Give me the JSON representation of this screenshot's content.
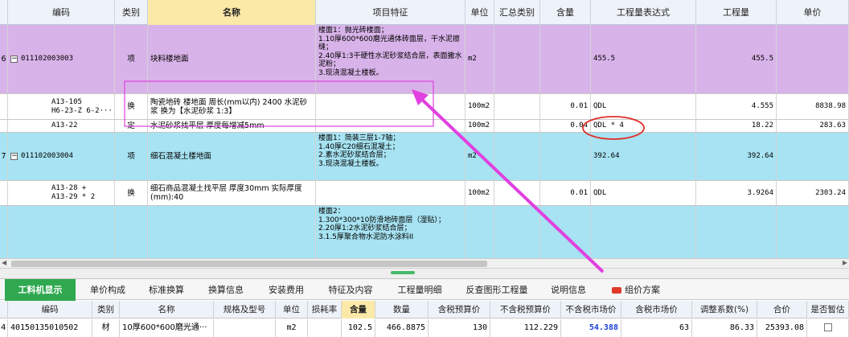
{
  "main_table": {
    "headers": [
      "编码",
      "类别",
      "名称",
      "项目特征",
      "单位",
      "汇总类别",
      "含量",
      "工程量表达式",
      "工程量",
      "单价"
    ],
    "rows": [
      {
        "num": "6",
        "code": "011102003003",
        "type": "项",
        "name": "块料楼地面",
        "features": "楼面1：抛光砖楼面；\n1.10厚600*600磨光通体砖面层，干水泥擦缝；\n2.40厚1:3干硬性水泥砂浆结合层，表面撒水泥粉；\n3.现浇混凝土楼板。",
        "unit": "m2",
        "sum_cat": "",
        "content": "",
        "expr": "455.5",
        "qty": "455.5",
        "price": ""
      },
      {
        "num": "",
        "code": "A13-105\nH6-23-Z 6-2···",
        "type": "换",
        "name": "陶瓷地砖 楼地面 周长(mm以内) 2400 水泥砂浆  换为【水泥砂浆 1:3】",
        "features": "",
        "unit": "100m2",
        "sum_cat": "",
        "content": "0.01",
        "expr": "QDL",
        "qty": "4.555",
        "price": "8838.98"
      },
      {
        "num": "",
        "code": "A13-22",
        "type": "定",
        "name": "水泥砂浆找平层 厚度每增减5mm",
        "features": "",
        "unit": "100m2",
        "sum_cat": "",
        "content": "0.04",
        "expr": "QDL * 4",
        "qty": "18.22",
        "price": "283.63"
      },
      {
        "num": "7",
        "code": "011102003004",
        "type": "项",
        "name": "细石混凝土楼地面",
        "features": "楼面1：简装三层1-7轴；\n1.40厚C20细石混凝土；\n2.素水泥砂浆结合层；\n3.现浇混凝土楼板。",
        "unit": "m2",
        "sum_cat": "",
        "content": "",
        "expr": "392.64",
        "qty": "392.64",
        "price": ""
      },
      {
        "num": "",
        "code": "A13-28 +\nA13-29 * 2",
        "type": "换",
        "name": "细石商品混凝土找平层 厚度30mm  实际厚度(mm):40",
        "features": "",
        "unit": "100m2",
        "sum_cat": "",
        "content": "0.01",
        "expr": "QDL",
        "qty": "3.9264",
        "price": "2303.24"
      },
      {
        "num": "",
        "code": "",
        "type": "",
        "name": "",
        "features": "楼面2：\n1.300*300*10防滑地砖面层（湿贴）；\n2.20厚1:2水泥砂浆结合层；\n3.1.5厚聚合物水泥防水涂料II",
        "unit": "",
        "sum_cat": "",
        "content": "",
        "expr": "",
        "qty": "",
        "price": ""
      }
    ]
  },
  "tabs": [
    "工料机显示",
    "单价构成",
    "标准换算",
    "换算信息",
    "安装费用",
    "特征及内容",
    "工程量明细",
    "反查图形工程量",
    "说明信息",
    "组价方案"
  ],
  "bottom_table": {
    "headers": [
      "编码",
      "类别",
      "名称",
      "规格及型号",
      "单位",
      "损耗率",
      "含量",
      "数量",
      "含税预算价",
      "不含税预算价",
      "不含税市场价",
      "含税市场价",
      "调整系数(%)",
      "合价",
      "是否暂估"
    ],
    "row": {
      "num": "4",
      "code": "40150135010502",
      "type": "材",
      "name": "10厚600*600磨光通···",
      "spec": "",
      "unit": "m2",
      "loss": "",
      "content": "102.5",
      "qty": "466.8875",
      "tax_budget": "130",
      "notax_budget": "112.229",
      "notax_market": "54.388",
      "tax_market": "63",
      "adj": "86.33",
      "total": "25393.08"
    }
  },
  "colors": {
    "purple_row": "#d8b3e9",
    "cyan_row": "#a7e3f2",
    "active_tab": "#2fa84f",
    "annotation": "#e040e0",
    "circle": "#e0302a",
    "highlight_value": "#1a3fd6"
  }
}
